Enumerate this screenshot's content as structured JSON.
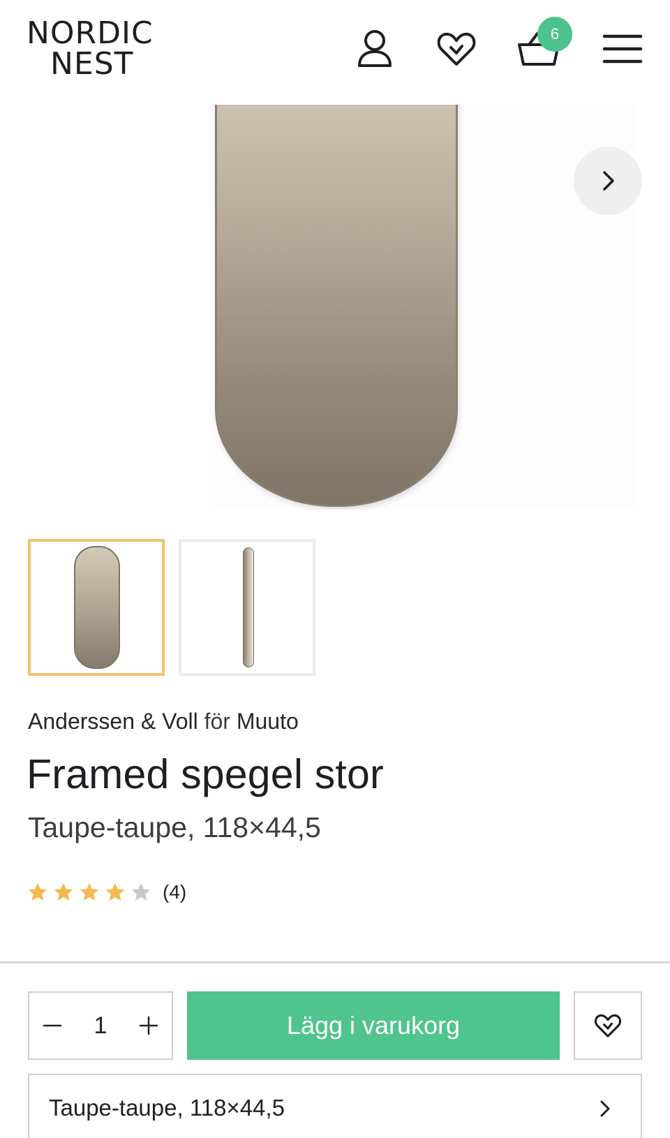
{
  "header": {
    "logo_line1": "NORDIC",
    "logo_line2": "NEST",
    "cart_count": "6",
    "icons": [
      "user-icon",
      "heart-icon",
      "basket-icon",
      "menu-icon"
    ]
  },
  "gallery": {
    "next_icon": "chevron-right-icon",
    "thumbnails": [
      "mirror-front",
      "mirror-side"
    ],
    "selected_thumbnail": 0
  },
  "product": {
    "designer": "Anderssen & Voll",
    "for_text": "för",
    "brand": "Muuto",
    "title": "Framed spegel stor",
    "variant": "Taupe-taupe, 118×44,5",
    "rating": 4,
    "rating_max": 5,
    "rating_count": "(4)"
  },
  "purchase": {
    "quantity": "1",
    "add_to_cart_label": "Lägg i varukorg",
    "variant_selector_label": "Taupe-taupe, 118×44,5"
  },
  "colors": {
    "accent_green": "#4fc48d",
    "badge_green": "#4cc38c",
    "star_filled": "#f5b94f",
    "star_empty": "#c8c8c8",
    "thumbnail_selected_border": "#f3c46d"
  }
}
